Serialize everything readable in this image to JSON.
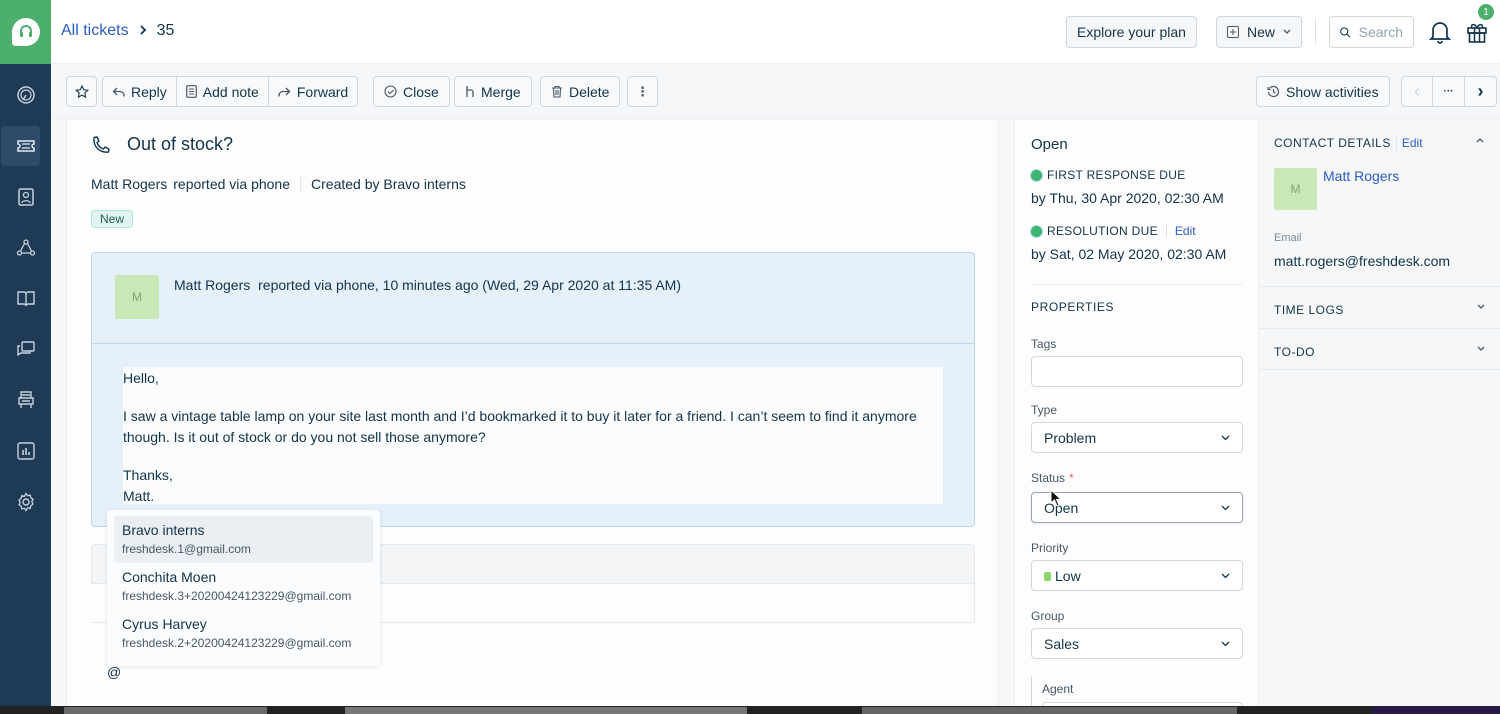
{
  "nav": {
    "brand_color": "#4caf6e",
    "items": [
      {
        "icon": "dashboard-icon",
        "active": false
      },
      {
        "icon": "tickets-icon",
        "active": true
      },
      {
        "icon": "contacts-icon",
        "active": false
      },
      {
        "icon": "social-icon",
        "active": false
      },
      {
        "icon": "knowledge-base-icon",
        "active": false
      },
      {
        "icon": "forums-icon",
        "active": false
      },
      {
        "icon": "admin-icon",
        "active": false
      },
      {
        "icon": "reports-icon",
        "active": false
      },
      {
        "icon": "settings-icon",
        "active": false
      }
    ]
  },
  "header": {
    "breadcrumb_link": "All tickets",
    "breadcrumb_separator": ">",
    "ticket_id": "35",
    "explore_label": "Explore your plan",
    "new_label": "New",
    "search_placeholder": "Search",
    "gift_badge_count": "1"
  },
  "toolbar": {
    "reply": "Reply",
    "add_note": "Add note",
    "forward": "Forward",
    "close": "Close",
    "merge": "Merge",
    "delete": "Delete",
    "more": "⋮",
    "show_activities": "Show activities",
    "prev": "‹",
    "ellipsis": "···",
    "next": "›"
  },
  "ticket": {
    "subject": "Out of stock?",
    "requester": "Matt Rogers",
    "source_text": "reported via phone",
    "created_by": "Created by Bravo interns",
    "status_tag": "New",
    "conversation": {
      "avatar_initial": "M",
      "author": "Matt Rogers",
      "meta": "reported via phone, 10 minutes ago (Wed, 29 Apr 2020 at 11:35 AM)",
      "body": [
        "Hello,",
        "",
        "I saw a vintage table lamp on your site last month and I’d bookmarked it to buy it later for a friend. I can’t seem to find it anymore though. Is it out of stock or do you not sell those anymore?",
        "",
        "Thanks,",
        "Matt."
      ]
    },
    "reply_input_value": "@",
    "mention_suggestions": [
      {
        "name": "Bravo interns",
        "email": "freshdesk.1@gmail.com",
        "selected": true
      },
      {
        "name": "Conchita Moen",
        "email": "freshdesk.3+20200424123229@gmail.com",
        "selected": false
      },
      {
        "name": "Cyrus Harvey",
        "email": "freshdesk.2+20200424123229@gmail.com",
        "selected": false
      }
    ]
  },
  "properties": {
    "status_title": "Open",
    "first_response_label": "FIRST RESPONSE DUE",
    "first_response_date": "by Thu, 30 Apr 2020, 02:30 AM",
    "resolution_label": "RESOLUTION DUE",
    "resolution_edit": "Edit",
    "resolution_date": "by Sat, 02 May 2020, 02:30 AM",
    "sla_color": "#3db671",
    "section_title": "PROPERTIES",
    "tags_label": "Tags",
    "tags_value": "",
    "type_label": "Type",
    "type_value": "Problem",
    "status_label": "Status",
    "status_required": "*",
    "status_value": "Open",
    "priority_label": "Priority",
    "priority_value": "Low",
    "priority_color": "#8ed56b",
    "group_label": "Group",
    "group_value": "Sales",
    "agent_label": "Agent"
  },
  "contact": {
    "title": "CONTACT DETAILS",
    "edit": "Edit",
    "avatar_initial": "M",
    "name": "Matt Rogers",
    "email_label": "Email",
    "email": "matt.rogers@freshdesk.com",
    "time_logs": "TIME LOGS",
    "todo": "TO-DO"
  }
}
